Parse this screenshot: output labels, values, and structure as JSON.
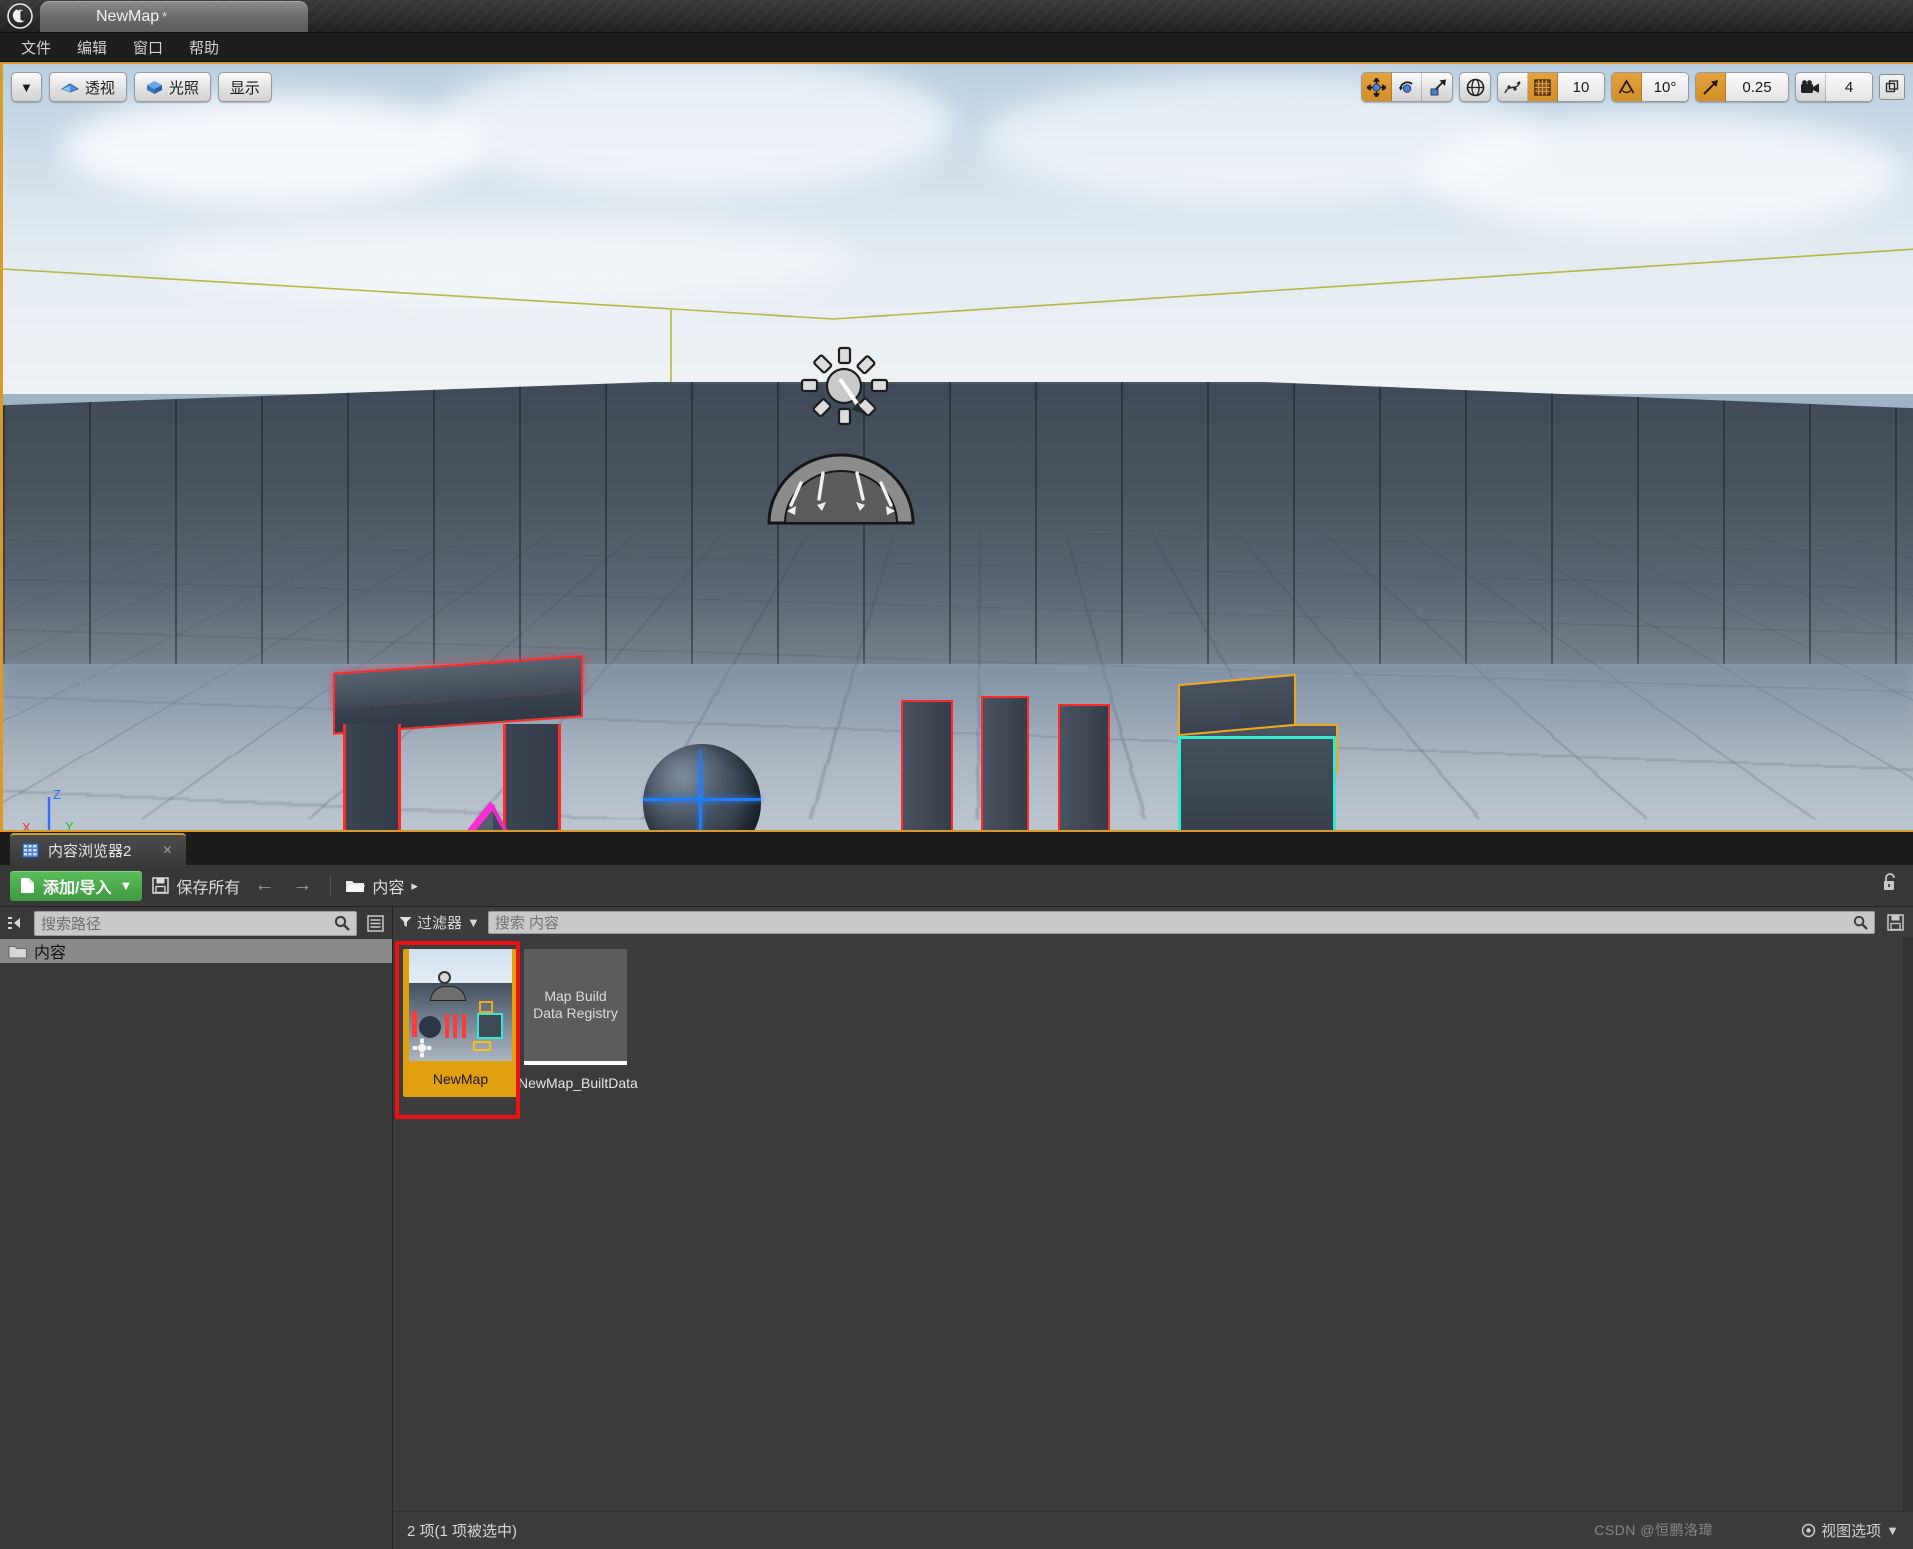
{
  "window": {
    "logo_icon": "unreal-engine-logo",
    "tab_title": "NewMap",
    "tab_dirty_marker": "*"
  },
  "menubar": {
    "items": [
      {
        "label": "文件"
      },
      {
        "label": "编辑"
      },
      {
        "label": "窗口"
      },
      {
        "label": "帮助"
      }
    ]
  },
  "viewport": {
    "toolbar_left": {
      "options_caret": "▼",
      "perspective_label": "透视",
      "lighting_label": "光照",
      "show_label": "显示"
    },
    "toolbar_right": {
      "transform_modes": [
        "translate-gizmo-icon",
        "rotate-gizmo-icon",
        "scale-gizmo-icon"
      ],
      "active_transform_mode": "translate-gizmo-icon",
      "coordinate_system_icon": "world-globe-icon",
      "surface_snap_icon": "surface-snap-icon",
      "grid_snap_icon": "grid-snap-icon",
      "grid_snap_value": "10",
      "grid_snap_enabled": true,
      "angle_snap_icon": "angle-snap-icon",
      "angle_snap_value": "10°",
      "angle_snap_enabled": true,
      "scale_snap_icon": "scale-snap-icon",
      "scale_snap_value": "0.25",
      "scale_snap_enabled": true,
      "camera_speed_icon": "camera-icon",
      "camera_speed_value": "4",
      "maximize_icon": "maximize-viewport-icon"
    },
    "axis_gizmo": {
      "x": "X",
      "y": "Y",
      "z": "Z",
      "help": "?"
    },
    "scene": {
      "sun_actor_icon": "directional-light-icon",
      "skylight_actor_icon": "sky-light-icon",
      "player_start_icon": "player-start-icon",
      "selection_colors": {
        "primary_selected": "#ff2b2b",
        "secondary_cyan": "#34e8d2",
        "secondary_orange": "#f0a81e",
        "secondary_magenta": "#ff2bd6",
        "sphere_blue": "#1f7dff",
        "light_wire": "#b3b840"
      }
    }
  },
  "content_browser": {
    "tab": {
      "icon": "content-browser-icon",
      "label": "内容浏览器2",
      "close": "✕"
    },
    "toolbar": {
      "add_import_label": "添加/导入",
      "add_import_caret": "▼",
      "save_all_label": "保存所有",
      "back_icon": "arrow-left-icon",
      "forward_icon": "arrow-right-icon",
      "path_folder_icon": "folder-icon",
      "path_label": "内容",
      "path_caret": "▸",
      "lock_icon": "unlock-icon"
    },
    "left_panel": {
      "collapse_icon": "collapse-sources-icon",
      "search_placeholder": "搜索路径",
      "search_icon": "search-icon",
      "options_icon": "list-options-icon",
      "tree": [
        {
          "icon": "folder-icon",
          "label": "内容",
          "selected": true
        }
      ]
    },
    "filter_bar": {
      "filter_icon": "funnel-icon",
      "filter_label": "过滤器",
      "filter_caret": "▼",
      "search_placeholder": "搜索 内容",
      "search_icon": "search-icon",
      "save_search_icon": "save-icon"
    },
    "assets": [
      {
        "name": "NewMap",
        "thumb_type": "level-thumbnail",
        "selected": true,
        "annotated": true,
        "badge_icon": "level-badge-icon"
      },
      {
        "name": "NewMap_BuiltData",
        "thumb_type": "text-thumbnail",
        "thumb_text": "Map Build Data Registry",
        "selected": false,
        "annotated": false
      }
    ],
    "status_bar": {
      "count_text": "2 项(1 项被选中)",
      "view_options_label": "视图选项",
      "view_options_caret": "▼",
      "watermark": "CSDN @恒鹏洛瑋"
    }
  },
  "colors": {
    "accent_orange": "#d89b2a",
    "selection_red": "#ee1111",
    "asset_selected": "#e0a010",
    "green_button": "#3f9b42",
    "panel_bg": "#3a3a3a",
    "toolbar_bg": "#383838"
  }
}
